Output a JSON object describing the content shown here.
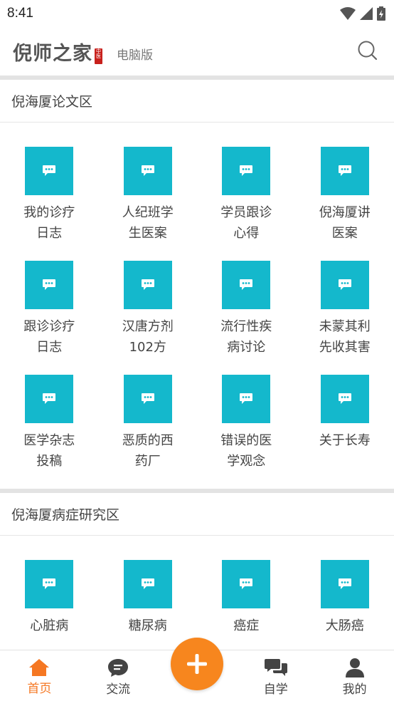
{
  "status_bar": {
    "time": "8:41"
  },
  "header": {
    "logo_text": "倪师之家",
    "logo_seal": "中医",
    "subtitle": "电脑版"
  },
  "sections": [
    {
      "title": "倪海厦论文区",
      "items": [
        {
          "label": "我的诊疗日志"
        },
        {
          "label": "人纪班学生医案"
        },
        {
          "label": "学员跟诊心得"
        },
        {
          "label": "倪海厦讲医案"
        },
        {
          "label": "跟诊诊疗日志"
        },
        {
          "label": "汉唐方剂102方"
        },
        {
          "label": "流行性疾病讨论"
        },
        {
          "label": "未蒙其利先收其害"
        },
        {
          "label": "医学杂志投稿"
        },
        {
          "label": "恶质的西药厂"
        },
        {
          "label": "错误的医学观念"
        },
        {
          "label": "关于长寿"
        }
      ]
    },
    {
      "title": "倪海厦病症研究区",
      "items": [
        {
          "label": "心脏病"
        },
        {
          "label": "糖尿病"
        },
        {
          "label": "癌症"
        },
        {
          "label": "大肠癌"
        }
      ]
    }
  ],
  "bottom_nav": {
    "home": "首页",
    "exchange": "交流",
    "study": "自学",
    "mine": "我的"
  },
  "colors": {
    "tile": "#14b8cc",
    "accent": "#f57722",
    "fab": "#f7861e"
  },
  "icons": {
    "tile": "chat-bubble-icon",
    "search": "search-icon",
    "home": "home-icon",
    "exchange": "message-icon",
    "study": "chat-icon",
    "mine": "user-icon",
    "fab": "plus-icon"
  }
}
